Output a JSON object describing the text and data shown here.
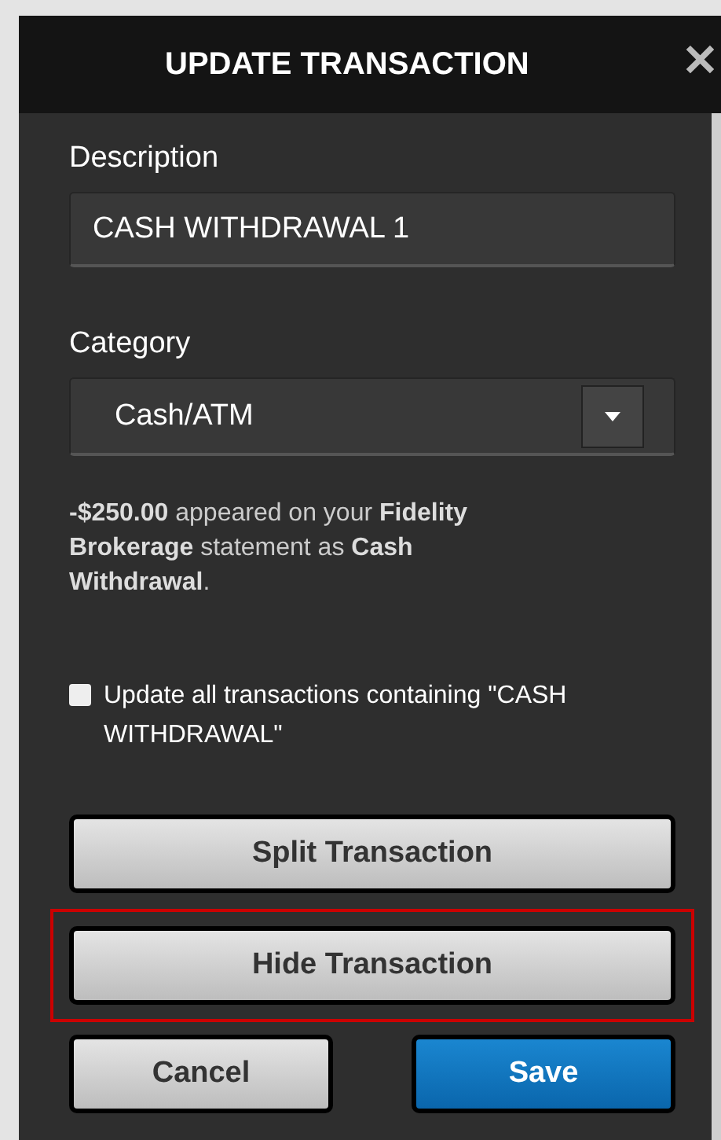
{
  "dialog": {
    "title": "UPDATE TRANSACTION",
    "close": "✕"
  },
  "description": {
    "label": "Description",
    "value": "CASH WITHDRAWAL 1"
  },
  "category": {
    "label": "Category",
    "value": "Cash/ATM"
  },
  "note": "**-$250.00** appeared on your **Fidelity Brokerage** statement as **Cash Withdrawal**.",
  "update_all": {
    "label": "Update all transactions containing \"CASH WITHDRAWAL\"",
    "checked": false
  },
  "buttons": [
    {
      "label": "Split Transaction",
      "kind": "secondary",
      "highlighted": false
    },
    {
      "label": "Hide Transaction",
      "kind": "secondary",
      "highlighted": true
    }
  ],
  "footer_buttons": [
    {
      "label": "Cancel",
      "kind": "secondary"
    },
    {
      "label": "Save",
      "kind": "primary"
    }
  ]
}
